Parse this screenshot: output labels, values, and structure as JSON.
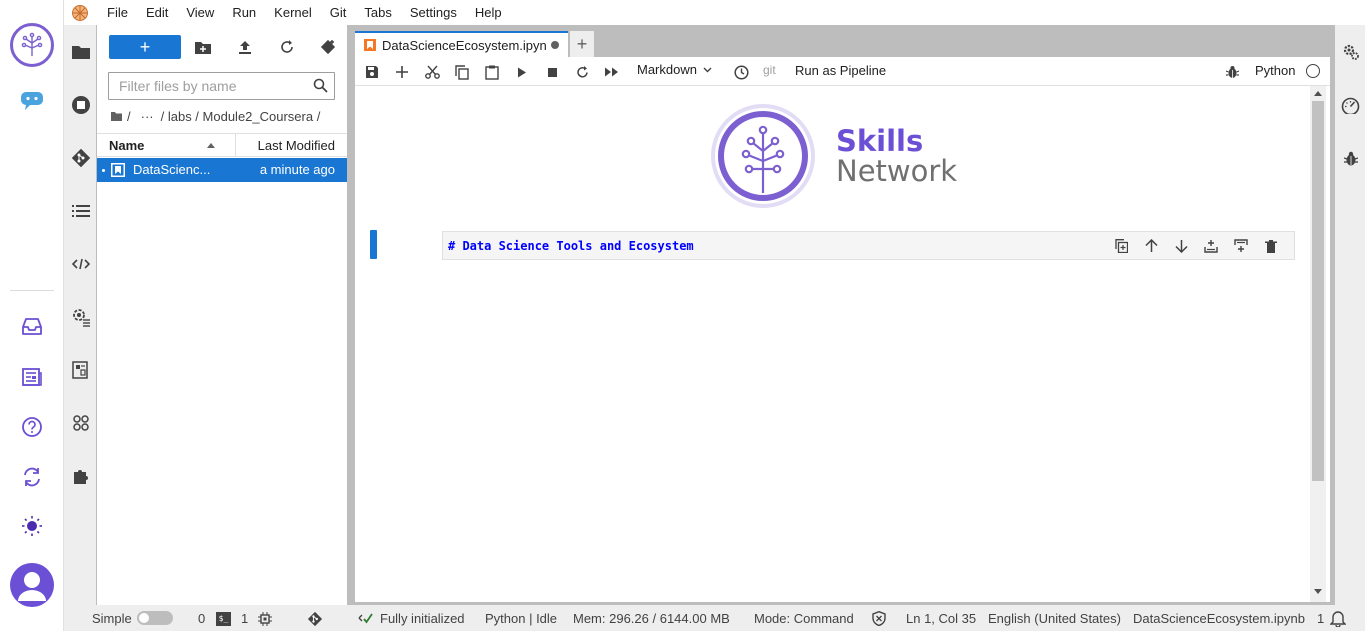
{
  "menubar": {
    "items": [
      "File",
      "Edit",
      "View",
      "Run",
      "Kernel",
      "Git",
      "Tabs",
      "Settings",
      "Help"
    ]
  },
  "filebrowser": {
    "new_label": "+",
    "search_placeholder": "Filter files by name",
    "breadcrumb": {
      "root": "/",
      "ellipsis": "···",
      "path": "/ labs / Module2_Coursera /"
    },
    "columns": {
      "name": "Name",
      "modified": "Last Modified"
    },
    "files": [
      {
        "name": "DataScienc...",
        "modified": "a minute ago"
      }
    ]
  },
  "notebook": {
    "tab_label": "DataScienceEcosystem.ipyn",
    "add_tab": "+",
    "cell_type": "Markdown",
    "git_label": "git",
    "pipeline_label": "Run as Pipeline",
    "kernel_name": "Python",
    "banner": {
      "line1": "Skills",
      "line2": "Network"
    },
    "cell_source": "# Data Science Tools and Ecosystem"
  },
  "statusbar": {
    "mode_label": "Simple",
    "terminals_count": "0",
    "terminal_badge": "$_",
    "kernels_count": "1",
    "init_status": "Fully initialized",
    "kernel_status": "Python | Idle",
    "memory": "Mem: 296.26 / 6144.00 MB",
    "command_mode": "Mode: Command",
    "cursor_pos": "Ln 1, Col 35",
    "language": "English (United States)",
    "file_name": "DataScienceEcosystem.ipynb",
    "notifications": "1"
  },
  "colors": {
    "accent": "#1976d2",
    "brand": "#6b4fd4",
    "frame": "#bdbdbd"
  }
}
